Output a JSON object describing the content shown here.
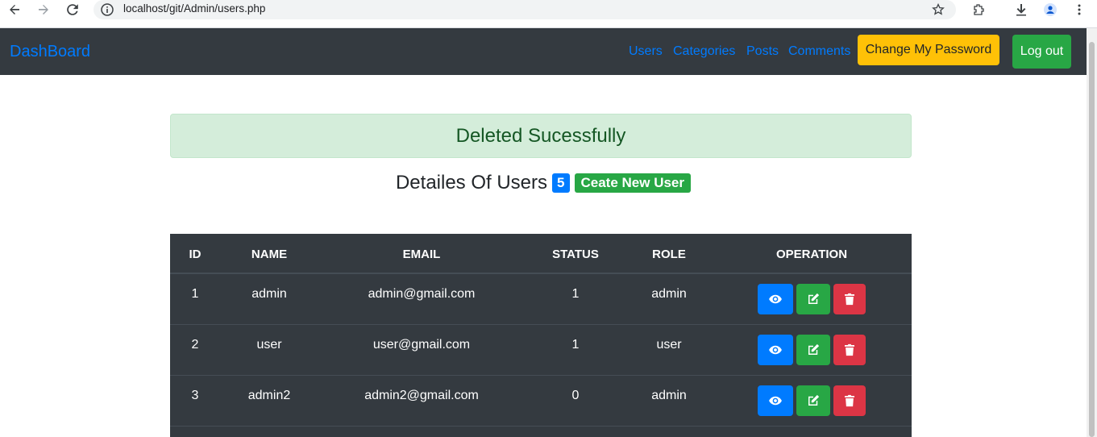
{
  "browser": {
    "url": "localhost/git/Admin/users.php"
  },
  "navbar": {
    "brand": "DashBoard",
    "links": [
      "Users",
      "Categories",
      "Posts",
      "Comments"
    ],
    "change_password": "Change My Password",
    "logout": "Log out"
  },
  "alert": {
    "message": "Deleted Sucessfully"
  },
  "heading": {
    "title": "Detailes Of Users",
    "count": "5",
    "create_label": "Ceate New User"
  },
  "table": {
    "headers": [
      "ID",
      "NAME",
      "EMAIL",
      "STATUS",
      "ROLE",
      "OPERATION"
    ],
    "rows": [
      {
        "id": "1",
        "name": "admin",
        "email": "admin@gmail.com",
        "status": "1",
        "role": "admin"
      },
      {
        "id": "2",
        "name": "user",
        "email": "user@gmail.com",
        "status": "1",
        "role": "user"
      },
      {
        "id": "3",
        "name": "admin2",
        "email": "admin2@gmail.com",
        "status": "0",
        "role": "admin"
      }
    ]
  },
  "colors": {
    "navbar_bg": "#343a40",
    "primary": "#007bff",
    "success": "#28a745",
    "warning": "#ffc107",
    "danger": "#dc3545",
    "alert_bg": "#d4edda"
  },
  "icons": {
    "view": "eye-icon",
    "edit": "edit-icon",
    "delete": "trash-icon"
  }
}
